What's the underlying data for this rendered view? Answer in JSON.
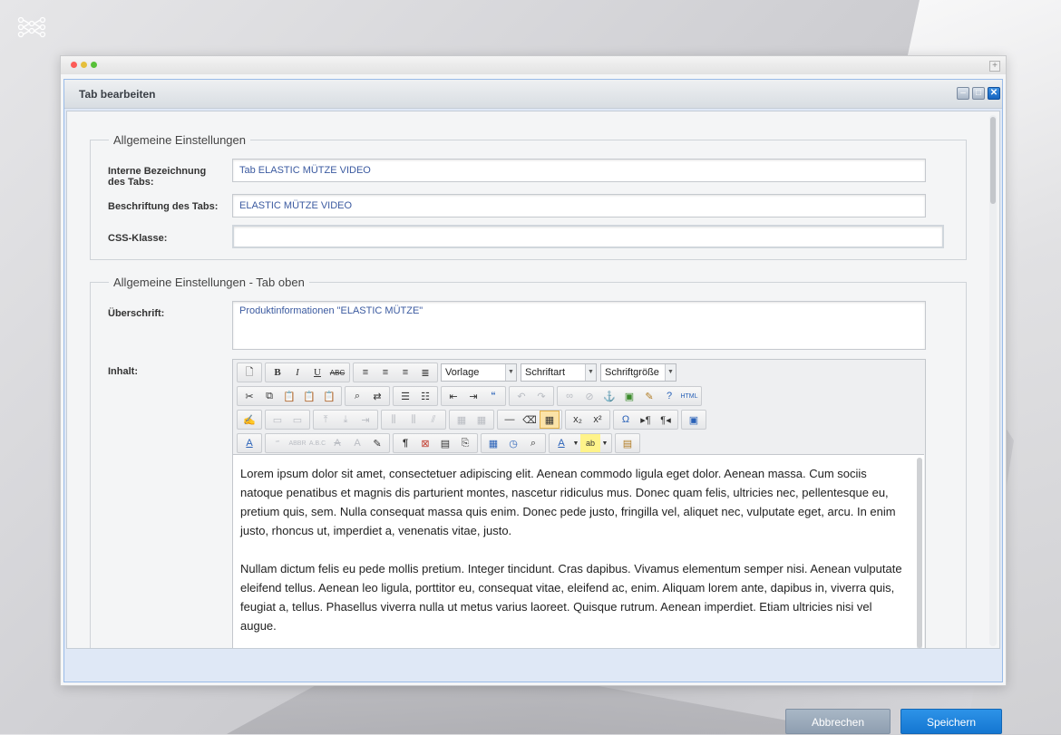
{
  "dialog": {
    "title": "Tab bearbeiten",
    "tools": [
      "minimize-tool",
      "maximize-tool",
      "close-tool"
    ]
  },
  "fieldset_general": {
    "legend": "Allgemeine Einstellungen",
    "internal_label": "Interne Bezeichnung des Tabs:",
    "internal_value": "Tab ELASTIC MÜTZE VIDEO",
    "caption_label": "Beschriftung des Tabs:",
    "caption_value": "ELASTIC MÜTZE VIDEO",
    "css_label": "CSS-Klasse:",
    "css_value": ""
  },
  "fieldset_top": {
    "legend": "Allgemeine Einstellungen - Tab oben",
    "heading_label": "Überschrift:",
    "heading_value": "Produktinformationen \"ELASTIC MÜTZE\"",
    "content_label": "Inhalt:"
  },
  "editor": {
    "combo_style": "Vorlage",
    "combo_font": "Schriftart",
    "combo_size": "Schriftgröße",
    "paragraph1": "Lorem ipsum dolor sit amet, consectetuer adipiscing elit. Aenean commodo ligula eget dolor. Aenean massa. Cum sociis natoque penatibus et magnis dis parturient montes, nascetur ridiculus mus. Donec quam felis, ultricies nec, pellentesque eu, pretium quis, sem. Nulla consequat massa quis enim. Donec pede justo, fringilla vel, aliquet nec, vulputate eget, arcu. In enim justo, rhoncus ut, imperdiet a, venenatis vitae, justo.",
    "paragraph2": "Nullam dictum felis eu pede mollis pretium. Integer tincidunt. Cras dapibus. Vivamus elementum semper nisi. Aenean vulputate eleifend tellus. Aenean leo ligula, porttitor eu, consequat vitae, eleifend ac, enim. Aliquam lorem ante, dapibus in, viverra quis, feugiat a, tellus. Phasellus viverra nulla ut metus varius laoreet. Quisque rutrum. Aenean imperdiet. Etiam ultricies nisi vel augue."
  },
  "buttons": {
    "cancel": "Abbrechen",
    "save": "Speichern"
  },
  "colors": {
    "accent": "#1a7fda",
    "dialog_border": "#99bbe8",
    "field_text": "#3b5aa0"
  }
}
